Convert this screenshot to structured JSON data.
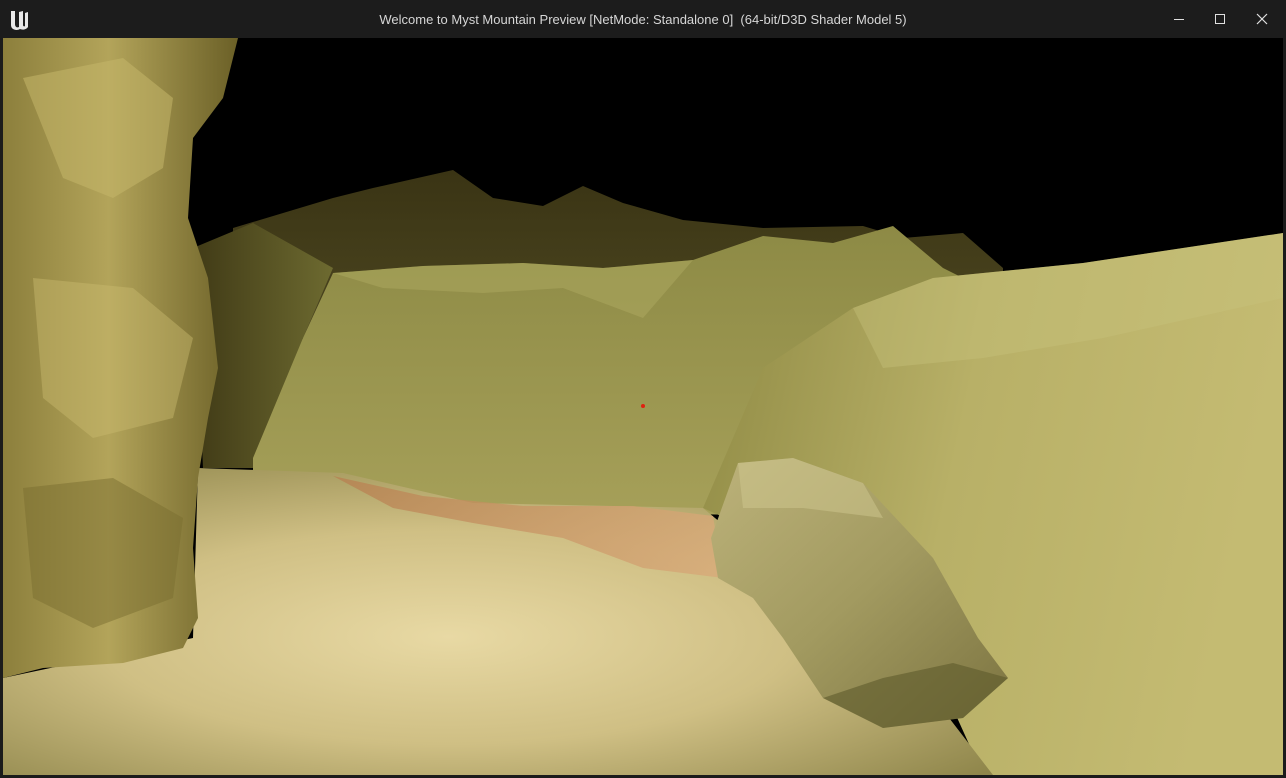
{
  "window": {
    "title": "Welcome to Myst Mountain Preview [NetMode: Standalone 0]  (64-bit/D3D Shader Model 5)",
    "logo_icon": "unreal-engine-logo",
    "controls": {
      "minimize_icon": "minimize-icon",
      "maximize_icon": "maximize-icon",
      "close_icon": "close-icon"
    }
  },
  "viewport": {
    "scene": "game-world-cave",
    "crosshair_color": "#e02010"
  },
  "colors": {
    "titlebar": "#1c1c1c",
    "title_text": "#d6d6d6",
    "sky": "#000000",
    "rock_light": "#c9c07a",
    "rock_mid": "#9e9848",
    "rock_dark": "#5a5522",
    "floor": "#d8c88f",
    "path": "#c99a6a"
  }
}
